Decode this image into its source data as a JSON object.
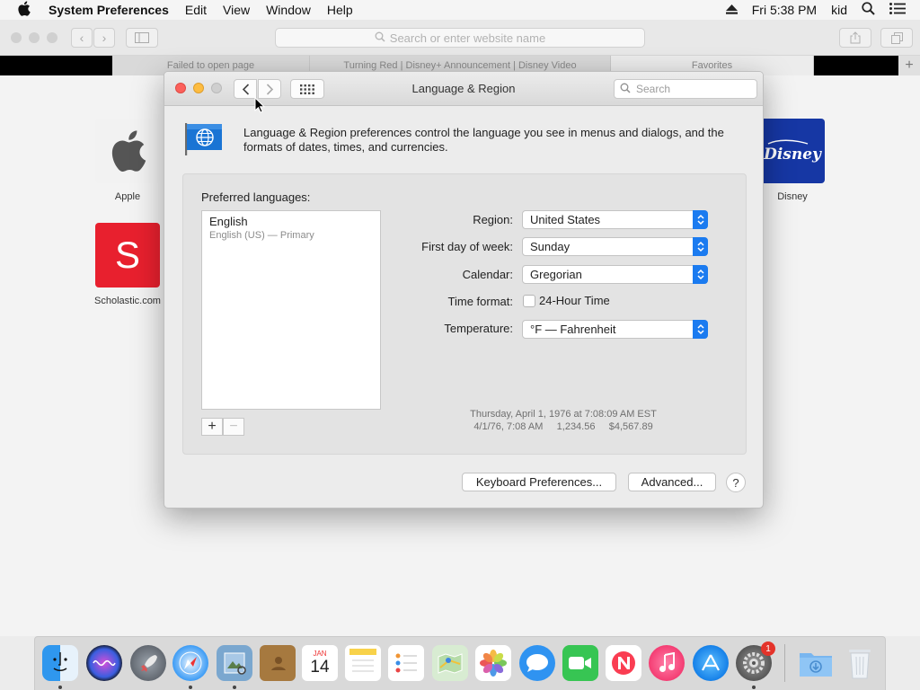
{
  "menubar": {
    "app_name": "System Preferences",
    "items": [
      "Edit",
      "View",
      "Window",
      "Help"
    ],
    "clock": "Fri 5:38 PM",
    "user": "kid"
  },
  "safari": {
    "url_placeholder": "Search or enter website name",
    "tabs": [
      "Failed to open page",
      "Turning Red | Disney+ Announcement | Disney Video",
      "Favorites"
    ],
    "favorites": [
      {
        "name": "Apple",
        "icon": "apple-icon"
      },
      {
        "name": "Disney",
        "icon": "disney-logo"
      },
      {
        "name": "Scholastic.com",
        "icon": "scholastic-icon",
        "glyph": "S"
      }
    ]
  },
  "dialog": {
    "title": "Language & Region",
    "search_placeholder": "Search",
    "intro": "Language & Region preferences control the language you see in menus and dialogs, and the formats of dates, times, and currencies.",
    "preferred_languages_label": "Preferred languages:",
    "languages": [
      {
        "name": "English",
        "detail": "English (US) — Primary"
      }
    ],
    "add_glyph": "+",
    "remove_glyph": "−",
    "region_label": "Region:",
    "region_value": "United States",
    "first_day_label": "First day of week:",
    "first_day_value": "Sunday",
    "calendar_label": "Calendar:",
    "calendar_value": "Gregorian",
    "time_format_label": "Time format:",
    "time_format_option": "24-Hour Time",
    "time_format_checked": false,
    "temperature_label": "Temperature:",
    "temperature_value": "°F — Fahrenheit",
    "sample_long": "Thursday, April 1, 1976 at 7:08:09 AM EST",
    "sample_short": "4/1/76, 7:08 AM     1,234.56     $4,567.89",
    "keyboard_button": "Keyboard Preferences...",
    "advanced_button": "Advanced...",
    "help_glyph": "?"
  },
  "dock": {
    "apps": [
      "Finder",
      "Siri",
      "Launchpad",
      "Safari",
      "Preview",
      "Contacts",
      "Calendar",
      "Notes",
      "Reminders",
      "Maps",
      "Photos",
      "Messages",
      "FaceTime",
      "News",
      "Music",
      "App Store",
      "System Preferences",
      "Downloads",
      "Trash"
    ],
    "calendar_month": "JAN",
    "calendar_day": "14",
    "badge": "1"
  },
  "colors": {
    "accent": "#1b7bf0",
    "close": "#fc605b",
    "minimize": "#fdbc40",
    "disney": "#1637a4",
    "scholastic": "#e8202e"
  }
}
